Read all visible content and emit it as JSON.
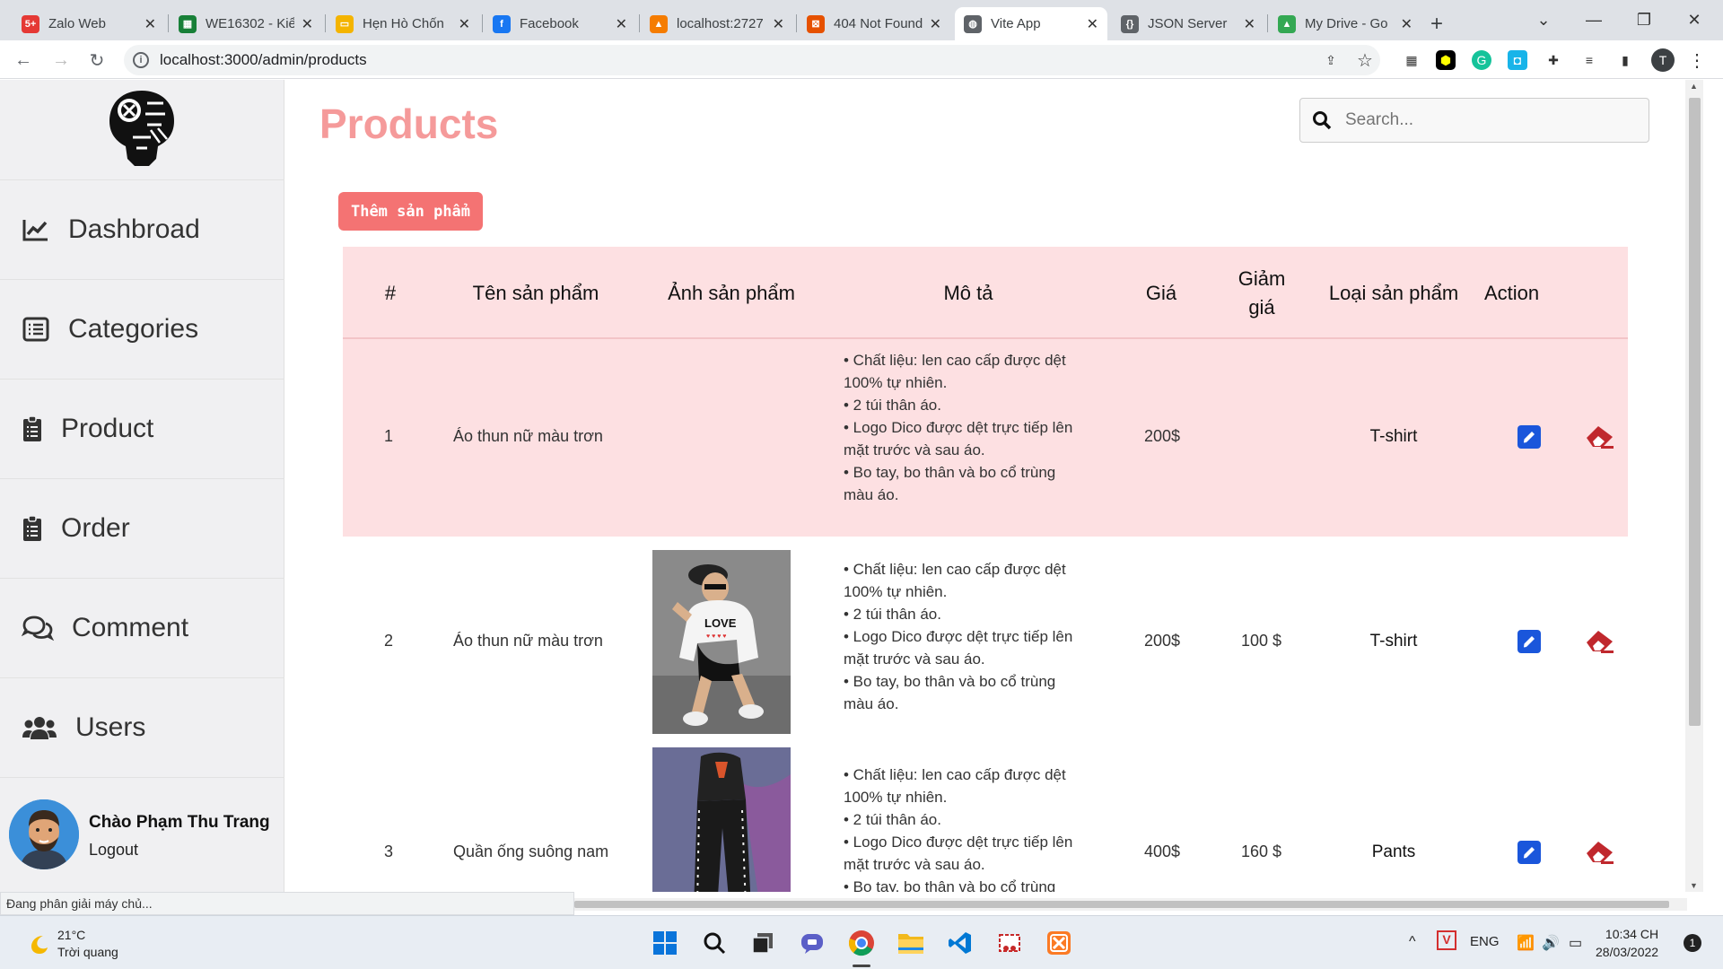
{
  "browser": {
    "tabs": [
      {
        "title": "Zalo Web",
        "fav_color": "#e53935",
        "fav_text": "5+"
      },
      {
        "title": "WE16302 - Kiể",
        "fav_color": "#188038",
        "fav_text": "▦"
      },
      {
        "title": "Hẹn Hò Chốn",
        "fav_color": "#f4b400",
        "fav_text": "▭"
      },
      {
        "title": "Facebook",
        "fav_color": "#1877f2",
        "fav_text": "f"
      },
      {
        "title": "localhost:2727",
        "fav_color": "#f57c00",
        "fav_text": "▲"
      },
      {
        "title": "404 Not Found",
        "fav_color": "#e65100",
        "fav_text": "⊠"
      },
      {
        "title": "Vite App",
        "fav_color": "#5f6368",
        "fav_text": "◍"
      },
      {
        "title": "JSON Server",
        "fav_color": "#5f6368",
        "fav_text": "{}"
      },
      {
        "title": "My Drive - Go",
        "fav_color": "#34a853",
        "fav_text": "▲"
      }
    ],
    "url": "localhost:3000/admin/products"
  },
  "sidebar": {
    "items": [
      {
        "label": "Dashbroad"
      },
      {
        "label": "Categories"
      },
      {
        "label": "Product"
      },
      {
        "label": "Order"
      },
      {
        "label": "Comment"
      },
      {
        "label": "Users"
      }
    ],
    "greeting": "Chào Phạm Thu Trang",
    "logout": "Logout"
  },
  "main": {
    "title": "Products",
    "search_placeholder": "Search...",
    "add_button": "Thêm sản phẩm",
    "columns": [
      "#",
      "Tên sản phẩm",
      "Ảnh sản phẩm",
      "Mô tả",
      "Giá",
      "Giảm giá",
      "Loại sản phẩm",
      "Action"
    ],
    "rows": [
      {
        "id": "1",
        "name": "Áo thun nữ màu trơn",
        "has_image": false,
        "description": [
          "• Chất liệu: len cao cấp được dệt",
          "100% tự nhiên.",
          "• 2 túi thân áo.",
          "• Logo Dico được dệt trực tiếp lên",
          "mặt trước và sau áo.",
          "• Bo tay, bo thân và bo cổ trùng",
          "màu áo."
        ],
        "price": "200$",
        "discount": "",
        "category": "T-shirt"
      },
      {
        "id": "2",
        "name": "Áo thun nữ màu trơn",
        "has_image": true,
        "image_text": "LOVE",
        "description": [
          "• Chất liệu: len cao cấp được dệt",
          "100% tự nhiên.",
          "• 2 túi thân áo.",
          "• Logo Dico được dệt trực tiếp lên",
          "mặt trước và sau áo.",
          "• Bo tay, bo thân và bo cổ trùng",
          "màu áo."
        ],
        "price": "200$",
        "discount": "100 $",
        "category": "T-shirt"
      },
      {
        "id": "3",
        "name": "Quần ống suông nam",
        "has_image": true,
        "description": [
          "• Chất liệu: len cao cấp được dệt",
          "100% tự nhiên.",
          "• 2 túi thân áo.",
          "• Logo Dico được dệt trực tiếp lên",
          "mặt trước và sau áo.",
          "• Bo tay, bo thân và bo cổ trùng"
        ],
        "price": "400$",
        "discount": "160 $",
        "category": "Pants"
      }
    ]
  },
  "status_text": "Đang phân giải máy chủ...",
  "taskbar": {
    "temperature": "21°C",
    "weather": "Trời quang",
    "lang": "ENG",
    "time": "10:34 CH",
    "date": "28/03/2022",
    "notification_count": "1"
  },
  "colors": {
    "accent": "#f47373",
    "title": "#f59a9a",
    "header_bg": "#fde0e2",
    "edit": "#1a56db",
    "delete": "#c0282d"
  }
}
